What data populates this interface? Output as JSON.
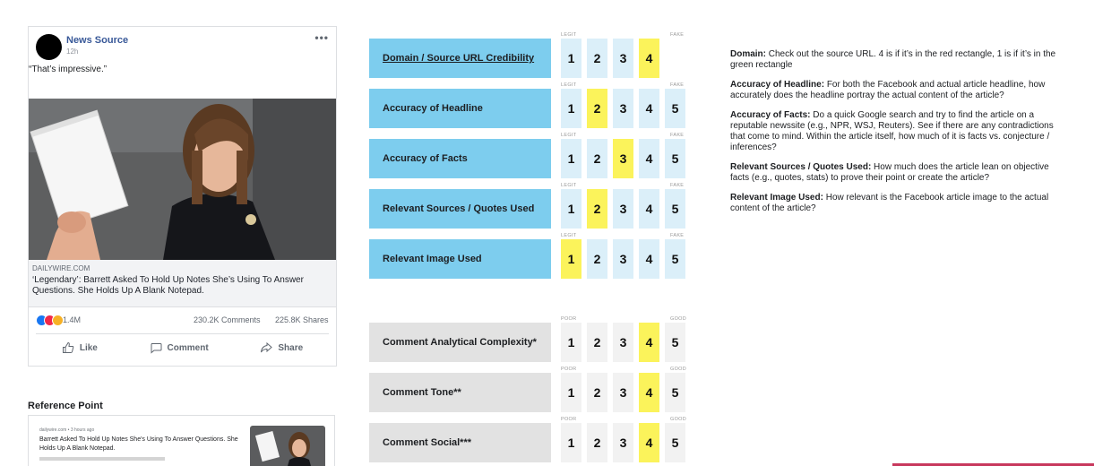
{
  "post": {
    "source_name": "News Source",
    "time": "12h",
    "more_label": "•••",
    "quote": "“That’s impressive.”",
    "link": {
      "domain": "DAILYWIRE.COM",
      "headline": "‘Legendary’: Barrett Asked To Hold Up Notes She’s Using To Answer Questions. She Holds Up A Blank Notepad."
    },
    "stats": {
      "reactions": "1.4M",
      "comments": "230.2K Comments",
      "shares": "225.8K Shares",
      "reaction_colors": [
        "#1877f2",
        "#f02849",
        "#f7b125"
      ]
    },
    "actions": [
      {
        "label": "Like",
        "icon": "thumbs-up-icon"
      },
      {
        "label": "Comment",
        "icon": "comment-icon"
      },
      {
        "label": "Share",
        "icon": "share-icon"
      }
    ]
  },
  "reference": {
    "title": "Reference Point",
    "meta": "dailywire.com • 3 hours ago",
    "headline": "Barrett Asked To Hold Up Notes She's Using To Answer Questions. She Holds Up A Blank Notepad."
  },
  "rating": {
    "scores": [
      "1",
      "2",
      "3",
      "4",
      "5"
    ],
    "criteria": [
      {
        "label": "Domain / Source URL Credibility",
        "low": "LEGIT",
        "high": "FAKE",
        "selected": 4,
        "style": "blue",
        "link": true,
        "max": 4
      },
      {
        "label": "Accuracy of Headline",
        "low": "LEGIT",
        "high": "FAKE",
        "selected": 2,
        "style": "blue",
        "link": false,
        "max": 5
      },
      {
        "label": "Accuracy of Facts",
        "low": "LEGIT",
        "high": "FAKE",
        "selected": 3,
        "style": "blue",
        "link": false,
        "max": 5
      },
      {
        "label": "Relevant Sources / Quotes Used",
        "low": "LEGIT",
        "high": "FAKE",
        "selected": 2,
        "style": "blue",
        "link": false,
        "max": 5
      },
      {
        "label": "Relevant Image Used",
        "low": "LEGIT",
        "high": "FAKE",
        "selected": 1,
        "style": "blue",
        "link": false,
        "max": 5
      },
      {
        "label": "Comment Analytical Complexity*",
        "low": "POOR",
        "high": "GOOD",
        "selected": 4,
        "style": "gray",
        "link": false,
        "max": 5
      },
      {
        "label": "Comment Tone**",
        "low": "POOR",
        "high": "GOOD",
        "selected": 4,
        "style": "gray",
        "link": false,
        "max": 5
      },
      {
        "label": "Comment Social***",
        "low": "POOR",
        "high": "GOOD",
        "selected": 4,
        "style": "gray",
        "link": false,
        "max": 5
      }
    ]
  },
  "instructions": [
    {
      "term": "Domain:",
      "text": " Check out the source URL. 4 is if it’s in the red rectangle, 1 is if it’s in the green rectangle"
    },
    {
      "term": "Accuracy of Headline:",
      "text": " For both the Facebook and actual article headline, how accurately does the headline portray the actual content of the article?"
    },
    {
      "term": "Accuracy of Facts:",
      "text": " Do a quick Google search and try to find the article on a reputable newssite (e.g., NPR, WSJ, Reuters). See if there are any contradictions that come to mind. Within the article itself, how much of it is facts vs. conjecture / inferences?"
    },
    {
      "term": "Relevant Sources / Quotes Used:",
      "text": " How much does the article lean on objective facts (e.g., quotes, stats) to prove their point or create the article?"
    },
    {
      "term": "Relevant Image Used:",
      "text": " How relevant is the Facebook article image to the actual content of the article?"
    }
  ],
  "colors": {
    "criteria_blue": "#7dcdee",
    "criteria_gray": "#e2e2e2",
    "selected_yellow": "#fbf35b",
    "source_link": "#385898"
  }
}
